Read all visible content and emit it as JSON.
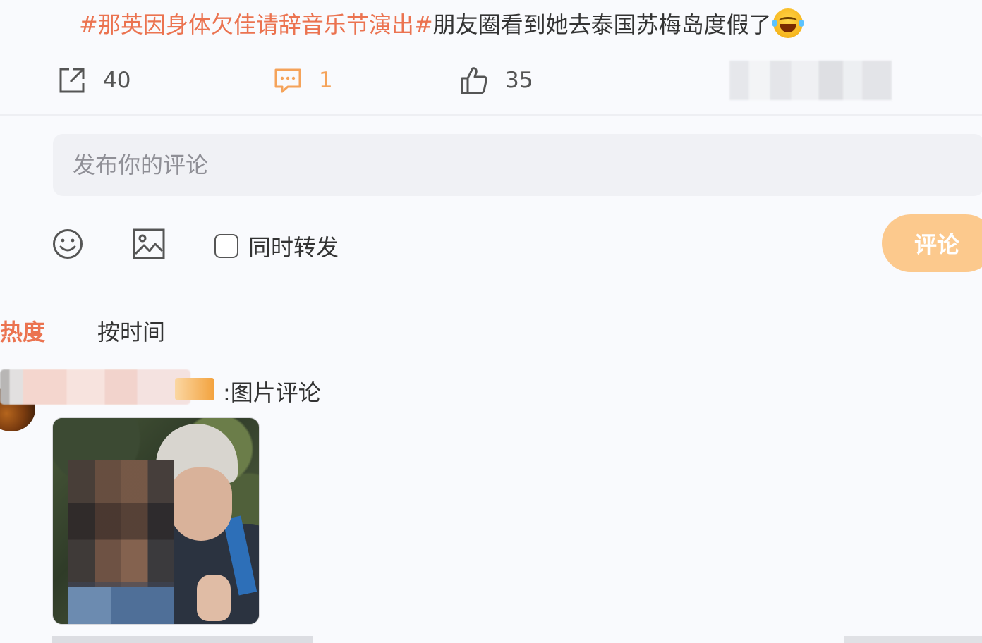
{
  "post": {
    "hashtag": "#那英因身体欠佳请辞音乐节演出#",
    "body": "朋友圈看到她去泰国苏梅岛度假了",
    "emoji_icon": "laugh-cry-emoji"
  },
  "actions": {
    "share_count": "40",
    "comment_count": "1",
    "like_count": "35",
    "share_icon": "share-icon",
    "comment_icon": "comment-icon",
    "like_icon": "thumbs-up-icon"
  },
  "comment_box": {
    "placeholder": "发布你的评论",
    "repost_label": "同时转发",
    "submit_label": "评论",
    "emoji_icon": "smiley-icon",
    "image_icon": "image-icon"
  },
  "sort": {
    "tabs": [
      {
        "label": "热度",
        "active": true
      },
      {
        "label": "按时间",
        "active": false
      }
    ]
  },
  "comment": {
    "text": ":图片评论"
  },
  "colors": {
    "accent": "#eb7350",
    "submit_bg": "#fcc98d",
    "comment_count": "#f5a35a",
    "input_bg": "#f0f1f5",
    "page_bg": "#f9fafd"
  }
}
